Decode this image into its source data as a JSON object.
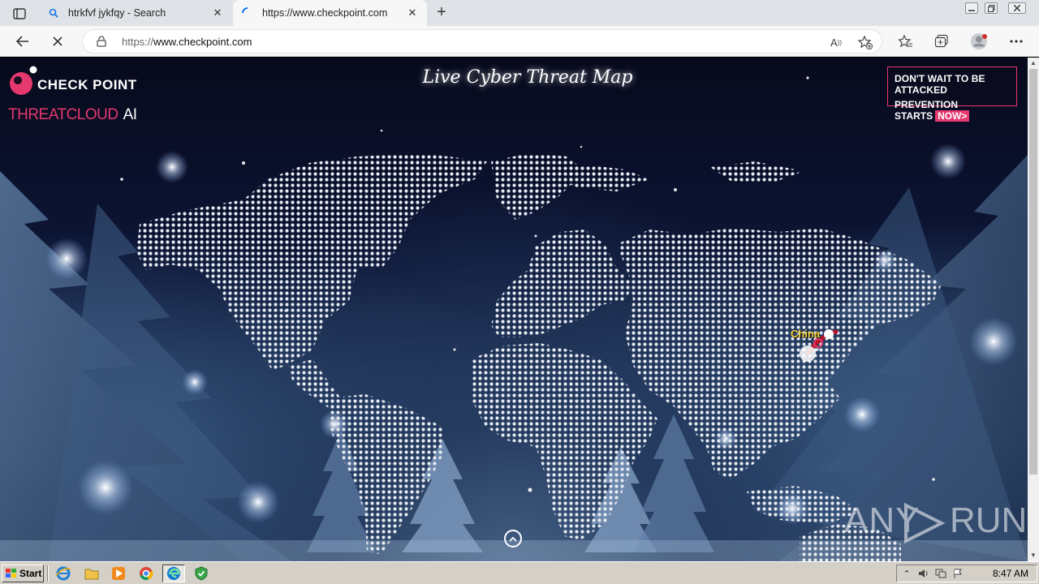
{
  "browser": {
    "tabs": [
      {
        "title": "htrkfvf jykfqy - Search",
        "icon": "search-icon",
        "active": false
      },
      {
        "title": "https://www.checkpoint.com",
        "icon": "loading-icon",
        "active": true
      }
    ],
    "address": {
      "scheme": "https://",
      "host": "www.checkpoint.com"
    }
  },
  "page": {
    "logo": {
      "brand": "CHECK POINT",
      "product": "THREATCLOUD",
      "product_suffix": "AI"
    },
    "title": "Live Cyber Threat Map",
    "banner": {
      "line1": "DON'T WAIT TO BE ATTACKED",
      "line2": "PREVENTION STARTS",
      "cta": "NOW>"
    },
    "attack_label": "China",
    "watermark": {
      "left": "ANY",
      "right": "RUN"
    }
  },
  "taskbar": {
    "start_label": "Start",
    "apps": [
      "ie-icon",
      "folder-icon",
      "media-player-icon",
      "chrome-icon",
      "edge-icon",
      "shield-icon"
    ],
    "clock": "8:47 AM"
  },
  "colors": {
    "brand_pink": "#e5386f",
    "label_yellow": "#f6d23b",
    "page_bg": "#0c1433"
  }
}
